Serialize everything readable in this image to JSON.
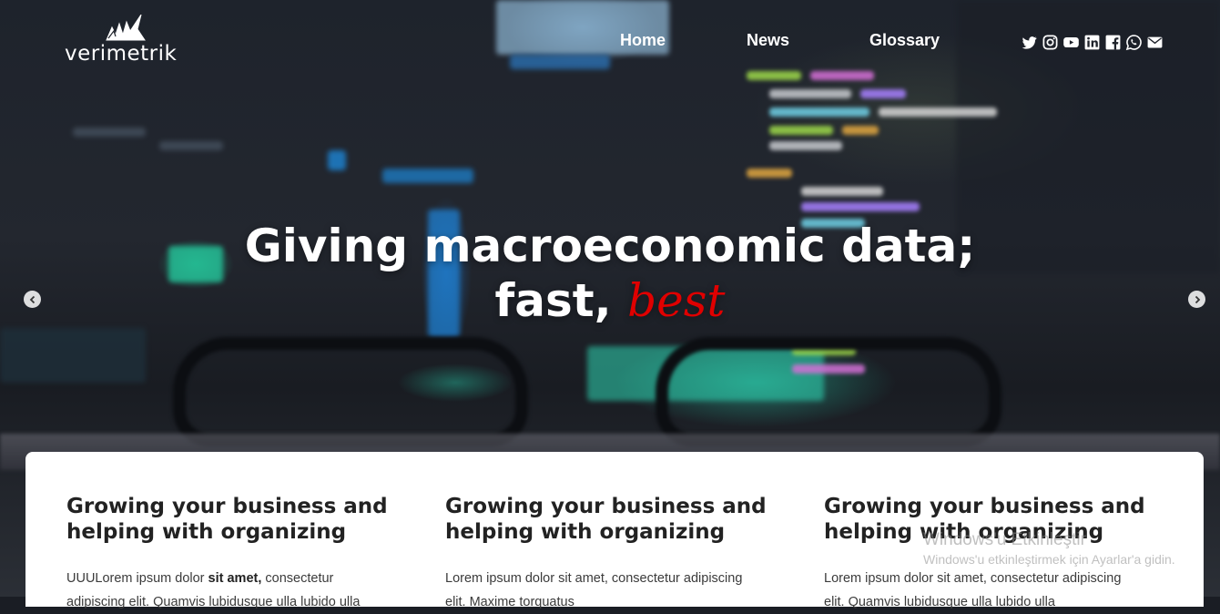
{
  "brand": {
    "name": "verimetrik"
  },
  "nav": {
    "items": [
      {
        "label": "Home"
      },
      {
        "label": "News"
      },
      {
        "label": "Glossary"
      }
    ]
  },
  "social": {
    "icons": [
      "twitter-icon",
      "instagram-icon",
      "youtube-icon",
      "linkedin-icon",
      "facebook-icon",
      "whatsapp-icon",
      "mail-icon"
    ]
  },
  "hero": {
    "line1": "Giving macroeconomic data;",
    "line2_prefix": "fast, ",
    "line2_accent": "best",
    "accent_color": "#e00000"
  },
  "cards": [
    {
      "title": "Growing your business and helping with organizing",
      "text_prefix": "UUULorem ipsum dolor ",
      "text_bold": "sit amet,",
      "text_suffix": " consectetur",
      "text_line2": "adipiscing elit. Quamvis lubidusque ulla lubido ulla"
    },
    {
      "title": "Growing your business and helping with organizing",
      "text": "Lorem ipsum dolor sit amet, consectetur adipiscing",
      "text_line2": "elit. Maxime torquatus"
    },
    {
      "title": "Growing your business and helping with organizing",
      "text": "Lorem ipsum dolor sit amet, consectetur adipiscing",
      "text_line2": "elit. Quamvis lubidusque ulla lubido ulla"
    }
  ],
  "watermark": {
    "title": "Windows'u Etkinleştir",
    "subtitle": "Windows'u etkinleştirmek için Ayarlar'a gidin."
  }
}
